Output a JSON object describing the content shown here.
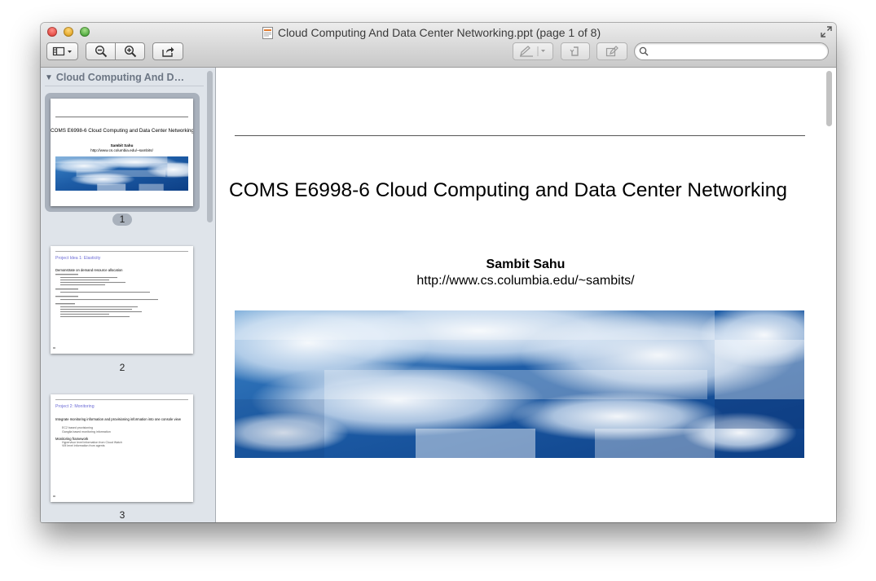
{
  "window": {
    "title": "Cloud Computing And Data Center Networking.ppt (page 1 of 8)"
  },
  "search": {
    "value": "",
    "placeholder": ""
  },
  "toolbar": {
    "sidebar_icon": "sidebar-view-icon",
    "zoom_out_icon": "zoom-out-icon",
    "zoom_in_icon": "zoom-in-icon",
    "share_icon": "share-icon",
    "annotate_icon": "pen-icon",
    "rotate_icon": "rotate-icon",
    "edit_icon": "edit-icon"
  },
  "sidebar": {
    "document_name": "Cloud Computing And Dat…",
    "thumbnails": [
      {
        "page_number": "1",
        "title": "COMS E6998-6 Cloud Computing and Data Center Networking",
        "author": "Sambit Sahu",
        "url": "http://www.cs.columbia.edu/~sambits/"
      },
      {
        "page_number": "2",
        "title": "Project Idea 1: Elasticity",
        "bullet": "Demonstrate on demand resource allocation"
      },
      {
        "page_number": "3",
        "title": "Project 2: Monitoring",
        "bullet1": "Integrate monitoring information and provisioning information into one console view",
        "sub1": "EC2 based provisioning",
        "sub2": "Ganglia based monitoring information",
        "bullet2": "Monitoring framework",
        "sub3": "Hypervisor level information from Cloud Watch",
        "sub4": "VM level information from agents"
      }
    ]
  },
  "slide": {
    "title": "COMS E6998-6 Cloud Computing and Data Center Networking",
    "author": "Sambit Sahu",
    "url": "http://www.cs.columbia.edu/~sambits/"
  },
  "colors": {
    "sidebar_bg": "#dfe4ea",
    "selection": "#a9b1bc",
    "sky_blue": "#1b5aa8",
    "slide2_title": "#6b6bd6"
  }
}
